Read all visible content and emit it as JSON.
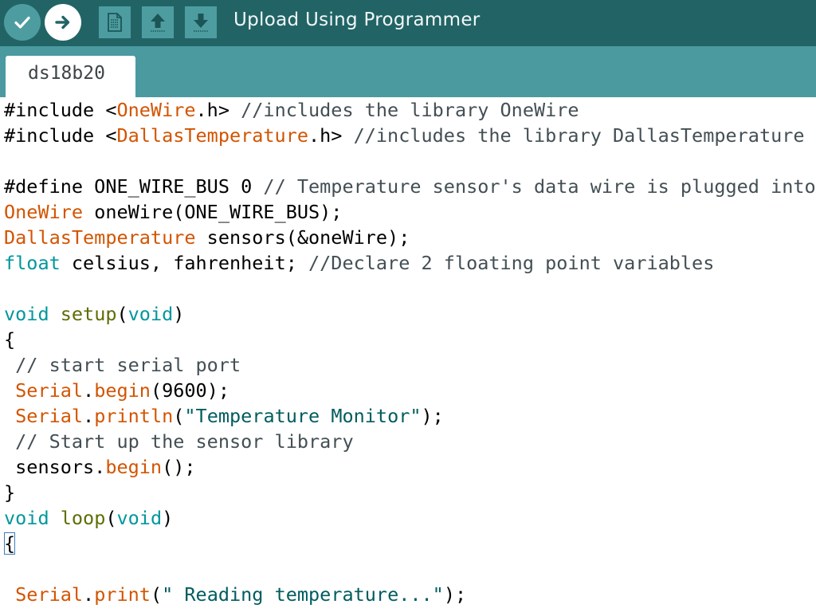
{
  "toolbar": {
    "label": "Upload Using Programmer",
    "buttons": [
      {
        "name": "verify",
        "icon": "checkmark-icon"
      },
      {
        "name": "upload",
        "icon": "arrow-right-icon"
      },
      {
        "name": "new",
        "icon": "new-file-icon"
      },
      {
        "name": "open",
        "icon": "arrow-up-icon"
      },
      {
        "name": "save",
        "icon": "arrow-down-icon"
      }
    ],
    "colors": {
      "background": "#226466",
      "button": "#4d9da0",
      "active_button": "#ffffff"
    }
  },
  "tabs": [
    {
      "label": "ds18b20",
      "active": true
    }
  ],
  "editor": {
    "colors": {
      "keyword": "#5e6d03",
      "type": "#00979c",
      "class": "#d35400",
      "comment": "#434f54",
      "string": "#005c5f"
    },
    "lines": [
      {
        "tokens": [
          {
            "t": "#include <",
            "c": "plain"
          },
          {
            "t": "OneWire",
            "c": "class"
          },
          {
            "t": ".h> ",
            "c": "plain"
          },
          {
            "t": "//includes the library OneWire",
            "c": "comment"
          }
        ]
      },
      {
        "tokens": [
          {
            "t": "#include <",
            "c": "plain"
          },
          {
            "t": "DallasTemperature",
            "c": "class"
          },
          {
            "t": ".h> ",
            "c": "plain"
          },
          {
            "t": "//includes the library DallasTemperature",
            "c": "comment"
          }
        ]
      },
      {
        "tokens": []
      },
      {
        "tokens": [
          {
            "t": "#define ONE_WIRE_BUS 0 ",
            "c": "plain"
          },
          {
            "t": "// Temperature sensor's data wire is plugged into",
            "c": "comment"
          }
        ]
      },
      {
        "tokens": [
          {
            "t": "OneWire",
            "c": "class"
          },
          {
            "t": " oneWire(ONE_WIRE_BUS);",
            "c": "plain"
          }
        ]
      },
      {
        "tokens": [
          {
            "t": "DallasTemperature",
            "c": "class"
          },
          {
            "t": " sensors(&oneWire);",
            "c": "plain"
          }
        ]
      },
      {
        "tokens": [
          {
            "t": "float",
            "c": "type"
          },
          {
            "t": " celsius, fahrenheit; ",
            "c": "plain"
          },
          {
            "t": "//Declare 2 floating point variables",
            "c": "comment"
          }
        ]
      },
      {
        "tokens": []
      },
      {
        "tokens": [
          {
            "t": "void",
            "c": "type"
          },
          {
            "t": " ",
            "c": "plain"
          },
          {
            "t": "setup",
            "c": "keyword"
          },
          {
            "t": "(",
            "c": "plain"
          },
          {
            "t": "void",
            "c": "type"
          },
          {
            "t": ")",
            "c": "plain"
          }
        ]
      },
      {
        "tokens": [
          {
            "t": "{",
            "c": "plain"
          }
        ]
      },
      {
        "tokens": [
          {
            "t": " // start serial port",
            "c": "comment"
          }
        ]
      },
      {
        "tokens": [
          {
            "t": " ",
            "c": "plain"
          },
          {
            "t": "Serial",
            "c": "class"
          },
          {
            "t": ".",
            "c": "plain"
          },
          {
            "t": "begin",
            "c": "class"
          },
          {
            "t": "(9600);",
            "c": "plain"
          }
        ]
      },
      {
        "tokens": [
          {
            "t": " ",
            "c": "plain"
          },
          {
            "t": "Serial",
            "c": "class"
          },
          {
            "t": ".",
            "c": "plain"
          },
          {
            "t": "println",
            "c": "class"
          },
          {
            "t": "(",
            "c": "plain"
          },
          {
            "t": "\"Temperature Monitor\"",
            "c": "string"
          },
          {
            "t": ");",
            "c": "plain"
          }
        ]
      },
      {
        "tokens": [
          {
            "t": " // Start up the sensor library",
            "c": "comment"
          }
        ]
      },
      {
        "tokens": [
          {
            "t": " sensors.",
            "c": "plain"
          },
          {
            "t": "begin",
            "c": "class"
          },
          {
            "t": "();",
            "c": "plain"
          }
        ]
      },
      {
        "tokens": [
          {
            "t": "}",
            "c": "plain"
          }
        ]
      },
      {
        "tokens": [
          {
            "t": "void",
            "c": "type"
          },
          {
            "t": " ",
            "c": "plain"
          },
          {
            "t": "loop",
            "c": "keyword"
          },
          {
            "t": "(",
            "c": "plain"
          },
          {
            "t": "void",
            "c": "type"
          },
          {
            "t": ")",
            "c": "plain"
          }
        ]
      },
      {
        "tokens": [
          {
            "t": "{",
            "c": "plain",
            "match": true
          }
        ]
      },
      {
        "tokens": []
      },
      {
        "tokens": [
          {
            "t": " ",
            "c": "plain"
          },
          {
            "t": "Serial",
            "c": "class"
          },
          {
            "t": ".",
            "c": "plain"
          },
          {
            "t": "print",
            "c": "class"
          },
          {
            "t": "(",
            "c": "plain"
          },
          {
            "t": "\" Reading temperature...\"",
            "c": "string"
          },
          {
            "t": ");",
            "c": "plain"
          }
        ]
      }
    ]
  }
}
